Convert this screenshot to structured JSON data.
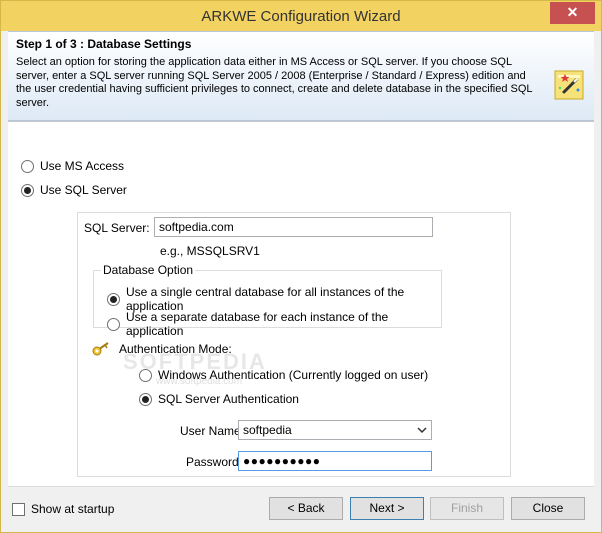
{
  "window": {
    "title": "ARKWE Configuration Wizard",
    "close_glyph": "✕"
  },
  "header": {
    "title": "Step 1 of 3 : Database Settings",
    "description": "Select an option for storing the application data either in MS Access or SQL server. If you choose SQL server, enter a SQL server running SQL Server 2005 / 2008 (Enterprise / Standard / Express) edition and the user credential having sufficient privileges to connect, create and delete database in the specified SQL server.",
    "icon": "wizard-wand-icon"
  },
  "storage": {
    "options": [
      {
        "label": "Use MS Access",
        "checked": false
      },
      {
        "label": "Use SQL Server",
        "checked": true
      }
    ]
  },
  "sql": {
    "server_label": "SQL Server:",
    "server_value": "softpedia.com",
    "server_example": "e.g., MSSQLSRV1",
    "db_option": {
      "title": "Database Option",
      "options": [
        {
          "label": "Use a single central database for all instances of the application",
          "checked": true
        },
        {
          "label": "Use a separate database for each instance of the application",
          "checked": false
        }
      ]
    },
    "auth": {
      "title": "Authentication Mode:",
      "icon": "key-icon",
      "options": [
        {
          "label": "Windows Authentication (Currently logged on user)",
          "checked": false
        },
        {
          "label": "SQL Server Authentication",
          "checked": true
        }
      ]
    },
    "username_label": "User Name:",
    "username_value": "softpedia",
    "password_label": "Password:",
    "password_value": "●●●●●●●●●●"
  },
  "watermark": {
    "main": "SOFTPEDIA",
    "sub": "www.softpedia.com"
  },
  "footer": {
    "show_at_startup_label": "Show at startup",
    "show_at_startup_checked": false,
    "back_label": "< Back",
    "next_label": "Next >",
    "finish_label": "Finish",
    "close_label": "Close"
  },
  "colors": {
    "title_bar": "#f2d260",
    "close_button": "#c75050",
    "focus_border": "#569de5"
  }
}
